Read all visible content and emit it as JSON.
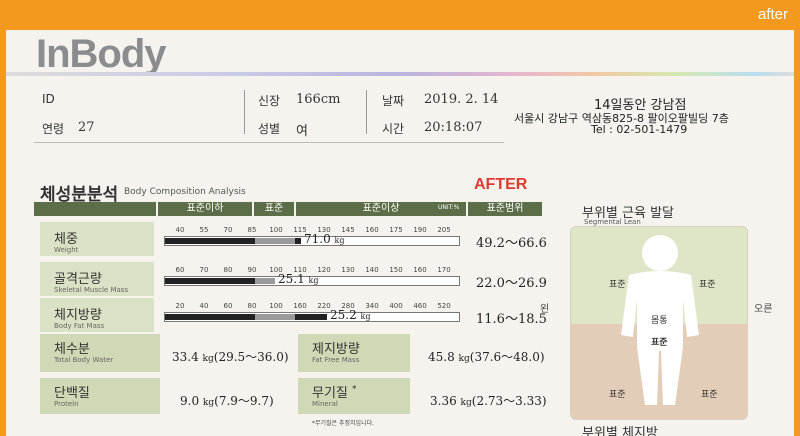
{
  "header": {
    "tag": "after"
  },
  "brand": {
    "logo": "InBody"
  },
  "info": {
    "id_label": "ID",
    "age_label": "연령",
    "age": "27",
    "height_label": "신장",
    "height": "166cm",
    "sex_label": "성별",
    "sex": "여",
    "date_label": "날짜",
    "date": "2019. 2. 14",
    "time_label": "시간",
    "time": "20:18:07",
    "store_name": "14일동안 강남점",
    "store_addr": "서울시 강남구 역삼동825-8 팔이오팔빌딩 7층",
    "store_tel": "Tel : 02-501-1479"
  },
  "analysis": {
    "title": "체성분분석",
    "subtitle": "Body Composition Analysis",
    "after": "AFTER",
    "headers": {
      "below": "표준이하",
      "std": "표준",
      "above": "표준이상",
      "unit": "UNIT:%",
      "range": "표준범위"
    },
    "rows": [
      {
        "kr": "체중",
        "en": "Weight",
        "ticks": [
          "40",
          "55",
          "70",
          "85",
          "100",
          "115",
          "130",
          "145",
          "160",
          "175",
          "190",
          "205"
        ],
        "value": "71.0",
        "unit": "kg",
        "range": "49.2～66.6",
        "pct": 0.47
      },
      {
        "kr": "골격근량",
        "en": "Skeletal Muscle Mass",
        "ticks": [
          "60",
          "70",
          "80",
          "90",
          "100",
          "110",
          "120",
          "130",
          "140",
          "150",
          "160",
          "170"
        ],
        "value": "25.1",
        "unit": "kg",
        "range": "22.0～26.9",
        "pct": 0.38
      },
      {
        "kr": "체지방량",
        "en": "Body Fat Mass",
        "ticks": [
          "20",
          "40",
          "60",
          "80",
          "100",
          "160",
          "220",
          "280",
          "340",
          "400",
          "460",
          "520"
        ],
        "value": "25.2",
        "unit": "kg",
        "range": "11.6～18.5",
        "pct": 0.56
      }
    ],
    "bottom": [
      {
        "kr": "체수분",
        "en": "Total Body Water",
        "value": "33.4",
        "unit": "kg",
        "range": "(29.5～36.0)"
      },
      {
        "kr": "제지방량",
        "en": "Fat Free Mass",
        "value": "45.8",
        "unit": "kg",
        "range": "(37.6～48.0)"
      },
      {
        "kr": "단백질",
        "en": "Protein",
        "value": "9.0",
        "unit": "kg",
        "range": "(7.9～9.7)"
      },
      {
        "kr": "무기질",
        "en": "Mineral",
        "mark": "*",
        "value": "3.36",
        "unit": "kg",
        "range": "(2.73～3.33)"
      }
    ],
    "note": "*무기질은 추정치입니다."
  },
  "segmental": {
    "title": "부위별 근육 발달",
    "subtitle": "Segmental Lean",
    "left": "왼",
    "right": "오른",
    "trunk": "몸통",
    "labels": {
      "la": "표준",
      "ra": "표준",
      "tr": "표준",
      "ll": "표준",
      "rl": "표준"
    },
    "next_title": "부위별 체지방"
  },
  "colors": {
    "header": "#f39a1e",
    "table_head": "#5c6e48",
    "row_bg": "#d9e2c4",
    "after": "#e03a2f"
  }
}
